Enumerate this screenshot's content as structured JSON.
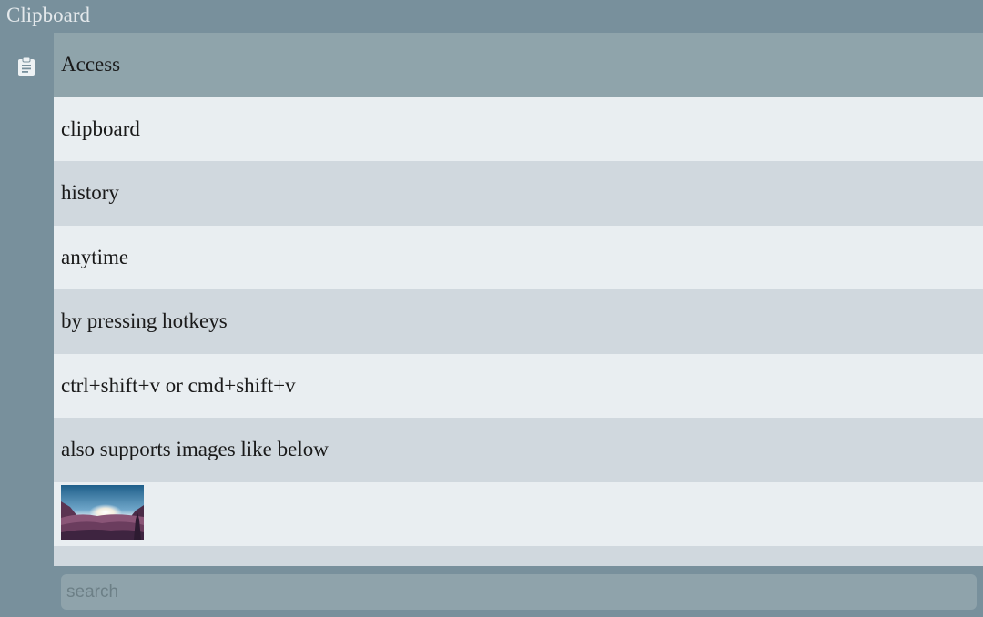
{
  "app": {
    "title": "Clipboard"
  },
  "sidebar": {
    "icon": "clipboard-icon"
  },
  "history": {
    "items": [
      {
        "type": "text",
        "text": "Access"
      },
      {
        "type": "text",
        "text": "clipboard"
      },
      {
        "type": "text",
        "text": "history"
      },
      {
        "type": "text",
        "text": "anytime"
      },
      {
        "type": "text",
        "text": "by pressing hotkeys"
      },
      {
        "type": "text",
        "text": "ctrl+shift+v or cmd+shift+v"
      },
      {
        "type": "text",
        "text": "also supports images like below"
      },
      {
        "type": "image",
        "image": "mountain-sunset-image"
      }
    ],
    "selected_index": 0
  },
  "search": {
    "placeholder": "search",
    "value": ""
  },
  "colors": {
    "background": "#78909c",
    "selected_row": "#8fa4ab",
    "row_light": "#e9eef1",
    "row_dark": "#d0d8de"
  }
}
